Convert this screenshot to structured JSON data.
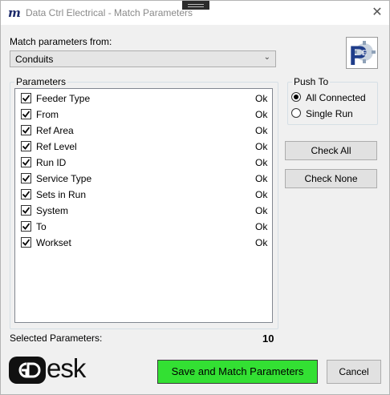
{
  "window": {
    "title": "Data Ctrl Electrical - Match Parameters",
    "close_glyph": "✕"
  },
  "match_from": {
    "label": "Match parameters from:",
    "selected": "Conduits"
  },
  "parameters": {
    "legend": "Parameters",
    "items": [
      {
        "name": "Feeder Type",
        "checked": true,
        "status": "Ok"
      },
      {
        "name": "From",
        "checked": true,
        "status": "Ok"
      },
      {
        "name": "Ref Area",
        "checked": true,
        "status": "Ok"
      },
      {
        "name": "Ref Level",
        "checked": true,
        "status": "Ok"
      },
      {
        "name": "Run ID",
        "checked": true,
        "status": "Ok"
      },
      {
        "name": "Service Type",
        "checked": true,
        "status": "Ok"
      },
      {
        "name": "Sets in Run",
        "checked": true,
        "status": "Ok"
      },
      {
        "name": "System",
        "checked": true,
        "status": "Ok"
      },
      {
        "name": "To",
        "checked": true,
        "status": "Ok"
      },
      {
        "name": "Workset",
        "checked": true,
        "status": "Ok"
      }
    ]
  },
  "push_to": {
    "legend": "Push To",
    "options": [
      {
        "label": "All Connected",
        "selected": true
      },
      {
        "label": "Single Run",
        "selected": false
      }
    ]
  },
  "buttons": {
    "check_all": "Check All",
    "check_none": "Check None",
    "save": "Save and Match Parameters",
    "cancel": "Cancel"
  },
  "footer": {
    "selected_label": "Selected Parameters:",
    "selected_count": "10",
    "logo_text": "esk"
  },
  "colors": {
    "save_button": "#33e033",
    "app_icon": "#1c2a6b",
    "badge": "#1f3d8a"
  },
  "icons": {
    "app": "m-logo-icon",
    "badge": "p-gear-badge-icon",
    "combo_arrow": "chevron-down-icon",
    "logo": "gdesk-logo-icon"
  }
}
